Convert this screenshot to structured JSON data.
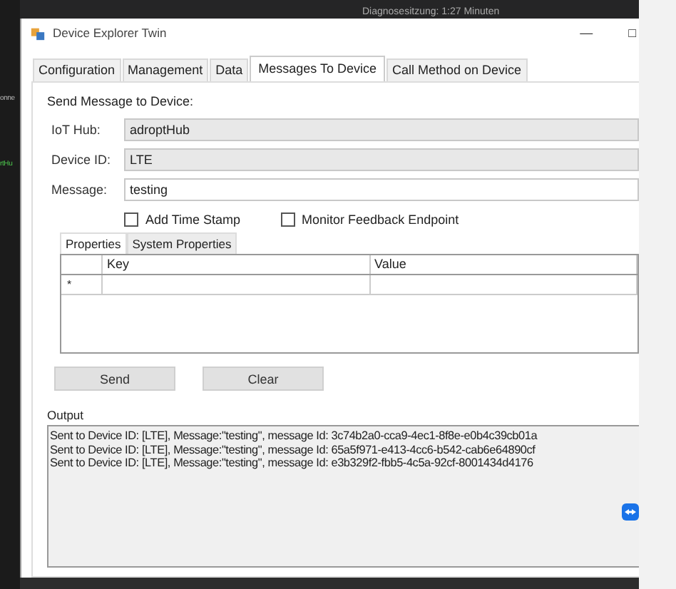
{
  "background": {
    "session_text": "Diagnosesitzung: 1:27 Minuten",
    "left_fragment": "onne",
    "code_fragment": "rtHu"
  },
  "window": {
    "title": "Device Explorer Twin",
    "minimize": "—",
    "maximize": "□"
  },
  "tabs": [
    {
      "label": "Configuration",
      "selected": false
    },
    {
      "label": "Management",
      "selected": false
    },
    {
      "label": "Data",
      "selected": false
    },
    {
      "label": "Messages To Device",
      "selected": true
    },
    {
      "label": "Call Method on Device",
      "selected": false
    }
  ],
  "heading": "Send Message to Device:",
  "fields": [
    {
      "label": "IoT Hub:",
      "value": "adroptHub",
      "disabled": true
    },
    {
      "label": "Device ID:",
      "value": "LTE",
      "disabled": true
    },
    {
      "label": "Message:",
      "value": "testing",
      "disabled": false
    }
  ],
  "checkboxes": [
    {
      "label": "Add Time Stamp",
      "checked": false
    },
    {
      "label": "Monitor Feedback Endpoint",
      "checked": false
    }
  ],
  "property_tabs": [
    {
      "label": "Properties",
      "selected": true
    },
    {
      "label": "System Properties",
      "selected": false
    }
  ],
  "grid": {
    "columns": [
      "Key",
      "Value"
    ],
    "new_row_marker": "*"
  },
  "buttons": [
    "Send",
    "Clear"
  ],
  "output": {
    "label": "Output",
    "lines": [
      "Sent to Device ID: [LTE], Message:\"testing\", message Id: 3c74b2a0-cca9-4ec1-8f8e-e0b4c39cb01a",
      "Sent to Device ID: [LTE], Message:\"testing\", message Id: 65a5f971-e413-4cc6-b542-cab6e64890cf",
      "Sent to Device ID: [LTE], Message:\"testing\", message Id: e3b329f2-fbb5-4c5a-92cf-8001434d4176"
    ]
  }
}
